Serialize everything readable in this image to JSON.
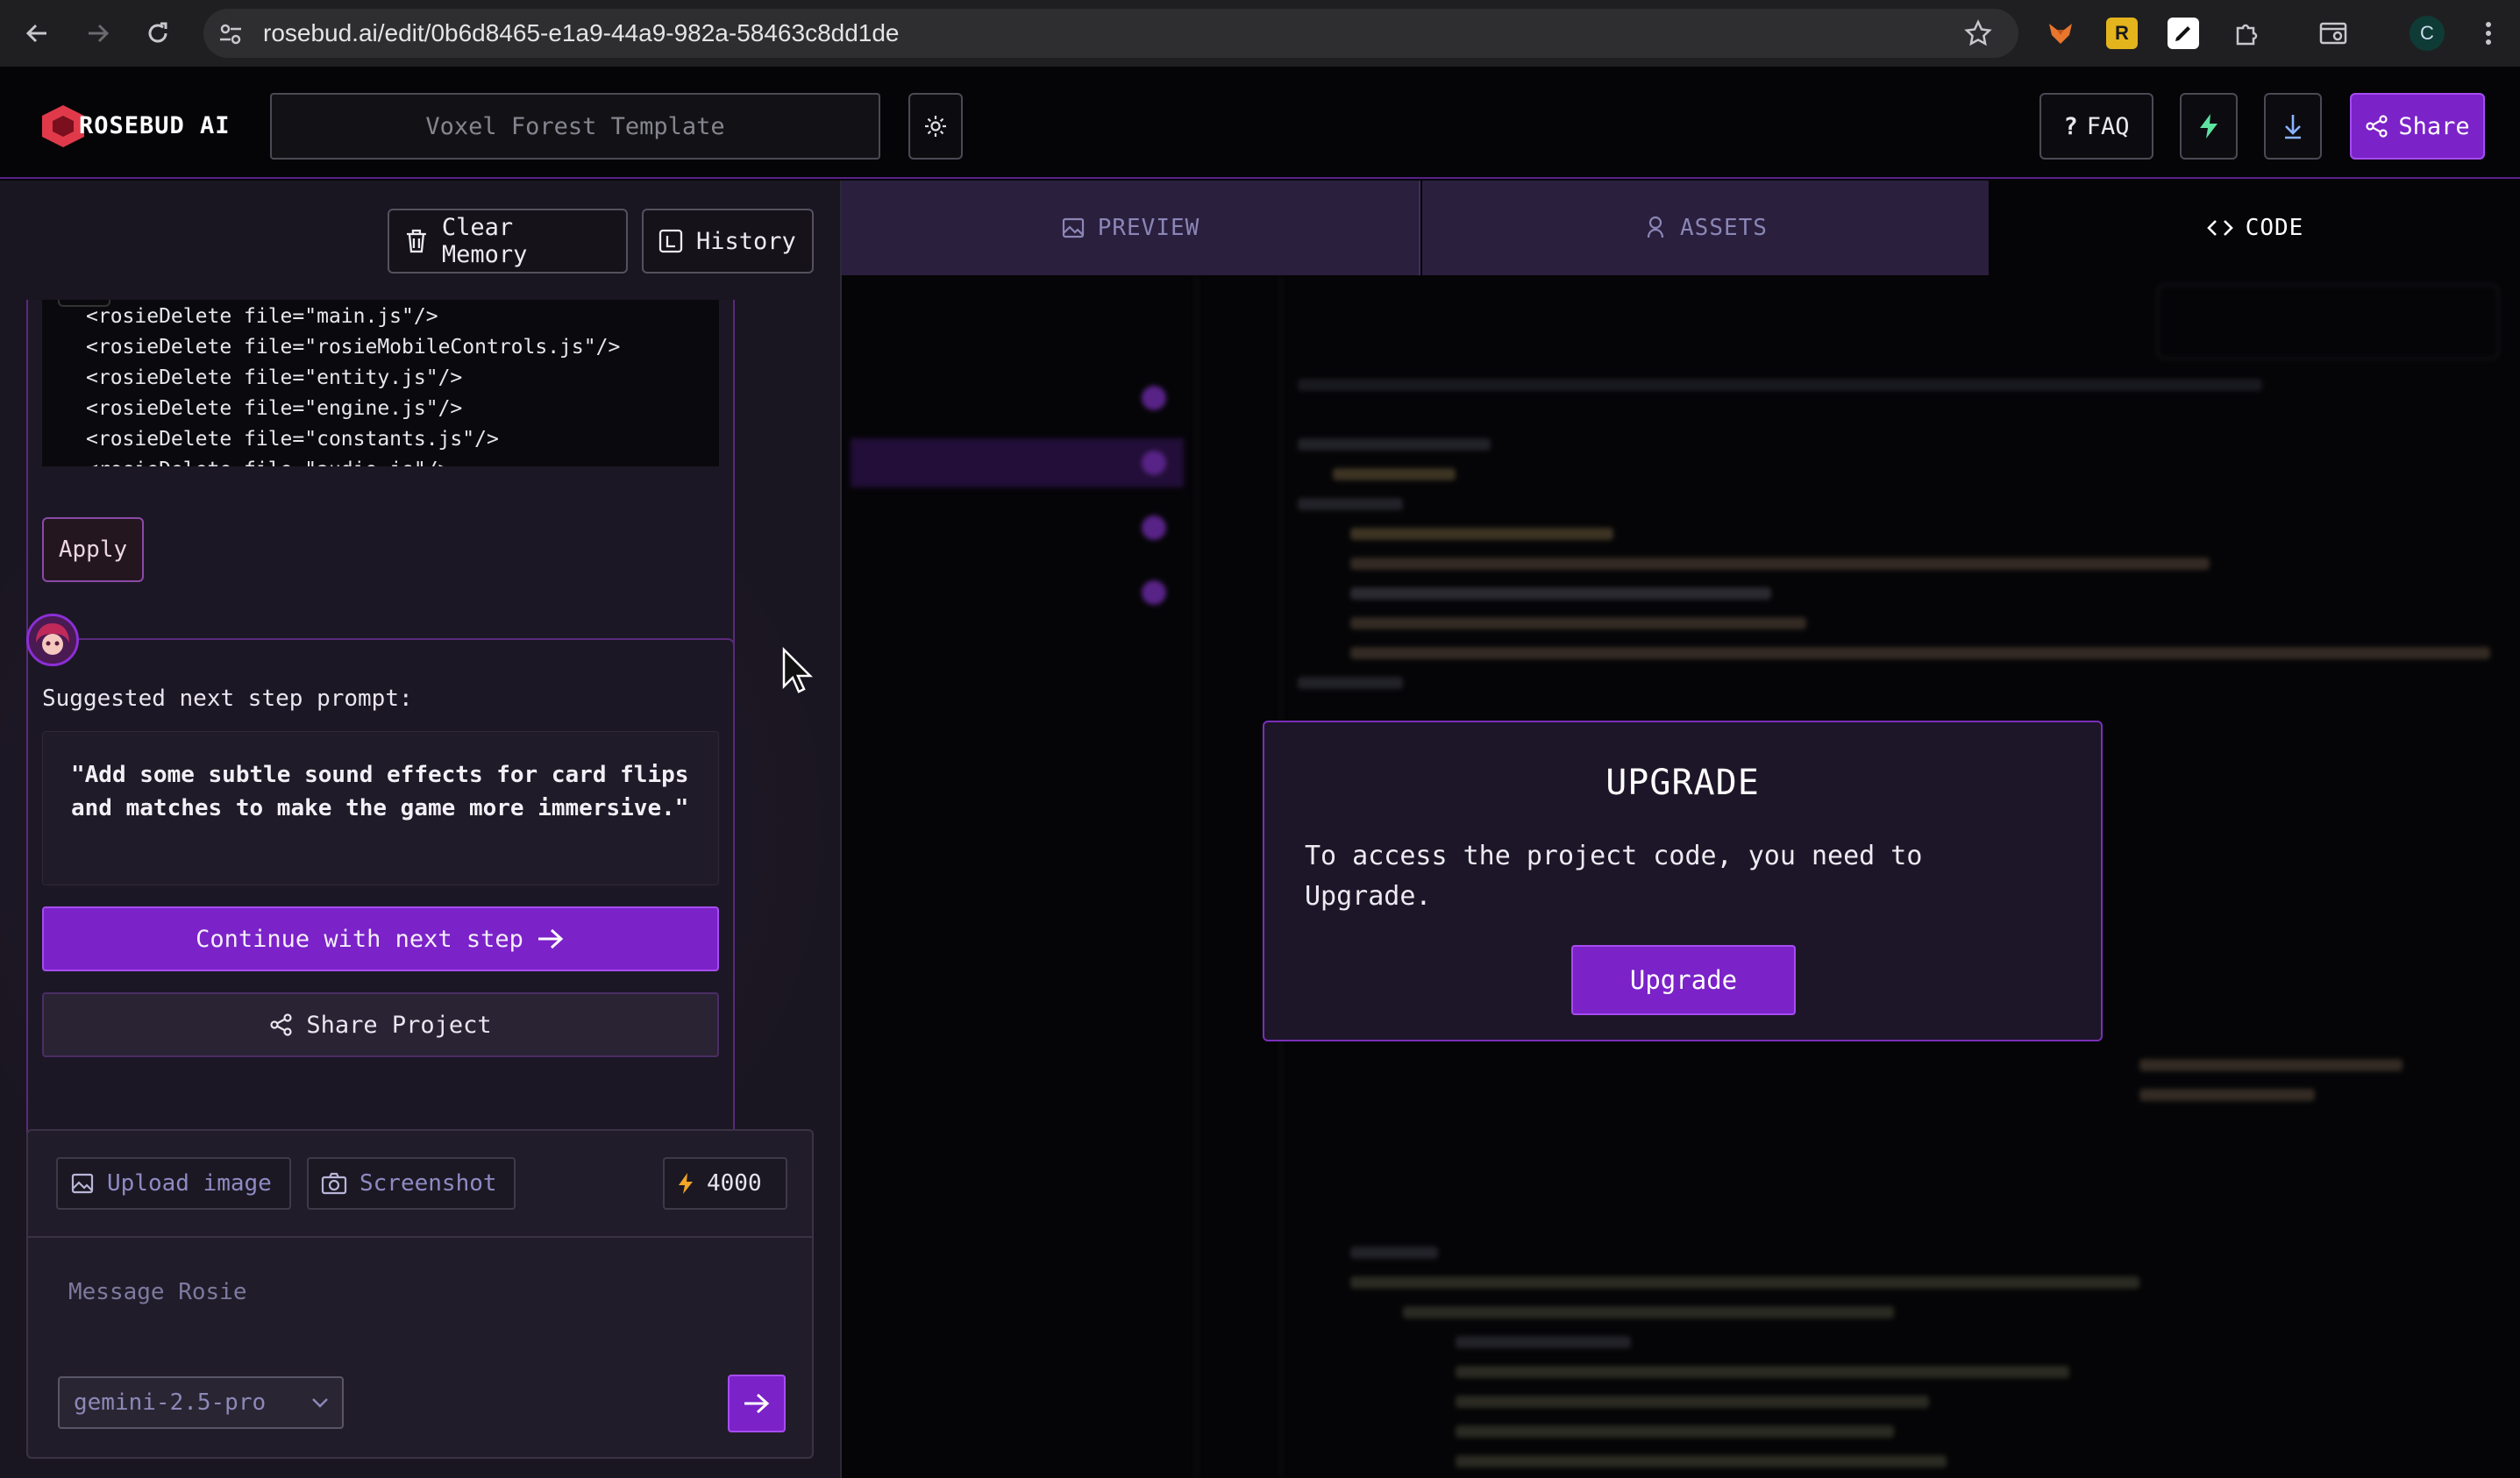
{
  "browser": {
    "url": "rosebud.ai/edit/0b6d8465-e1a9-44a9-982a-58463c8dd1de",
    "profile_initial": "C",
    "ext_r_label": "R"
  },
  "header": {
    "brand": "ROSEBUD AI",
    "project_name": "Voxel Forest Template",
    "faq_label": "FAQ",
    "faq_prefix": "?",
    "share_label": "Share"
  },
  "left": {
    "clear_memory_label": "Clear Memory",
    "history_label": "History",
    "code_lines": [
      {
        "prefix": "<rosieDelete file=",
        "file": "\"main.js\"",
        "suffix": "/>"
      },
      {
        "prefix": "<rosieDelete file=",
        "file": "\"rosieMobileControls.js\"",
        "suffix": "/>"
      },
      {
        "prefix": "<rosieDelete file=",
        "file": "\"entity.js\"",
        "suffix": "/>"
      },
      {
        "prefix": "<rosieDelete file=",
        "file": "\"engine.js\"",
        "suffix": "/>"
      },
      {
        "prefix": "<rosieDelete file=",
        "file": "\"constants.js\"",
        "suffix": "/>"
      },
      {
        "prefix": "<rosieDelete file=",
        "file": "\"audio.js\"",
        "suffix": "/>"
      }
    ],
    "apply_label": "Apply",
    "suggest_label": "Suggested next step prompt:",
    "suggest_text": "\"Add some subtle sound effects for card flips and matches to make the game more immersive.\"",
    "continue_label": "Continue with next step",
    "share_project_label": "Share Project"
  },
  "composer": {
    "upload_label": "Upload image",
    "screenshot_label": "Screenshot",
    "credits": "4000",
    "placeholder": "Message Rosie",
    "model": "gemini-2.5-pro"
  },
  "tabs": {
    "preview": "PREVIEW",
    "assets": "ASSETS",
    "code": "CODE"
  },
  "modal": {
    "title": "UPGRADE",
    "body": "To access the project code, you need to Upgrade.",
    "button": "Upgrade"
  },
  "colors": {
    "accent": "#7b22c9",
    "accent_border": "#a64cf0",
    "brand_red": "#e03a4a"
  }
}
